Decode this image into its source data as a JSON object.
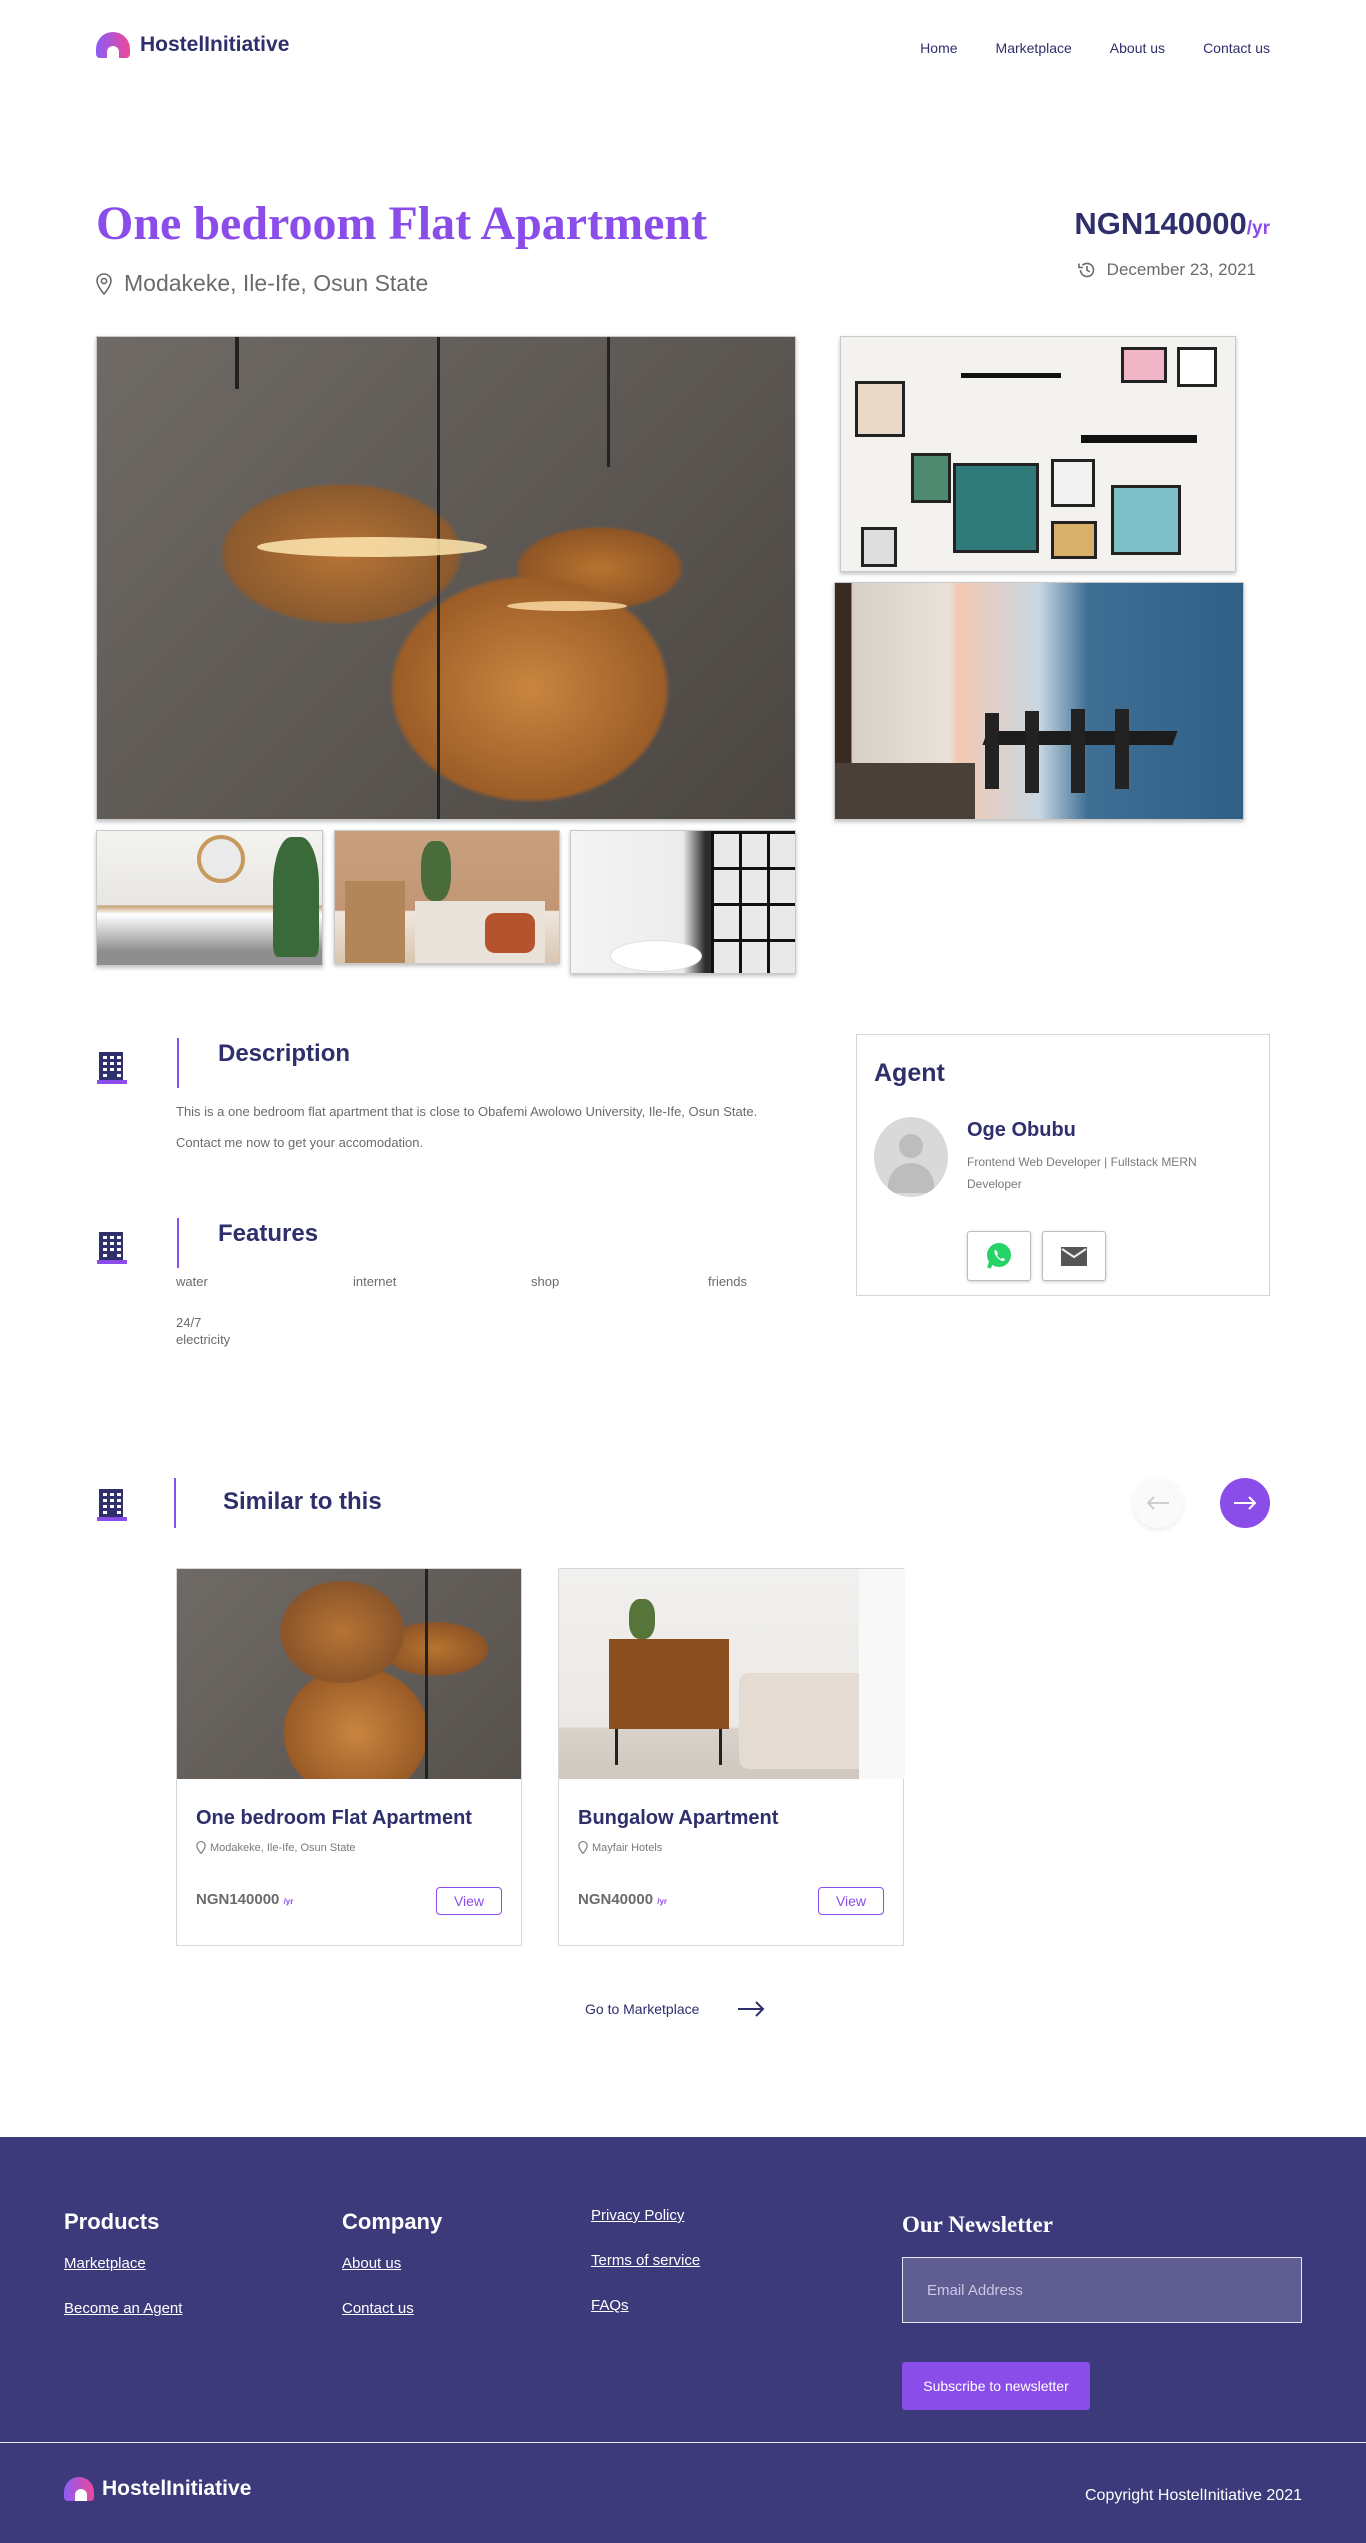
{
  "header": {
    "brand": "HostelInitiative",
    "nav": [
      "Home",
      "Marketplace",
      "About us",
      "Contact us"
    ]
  },
  "listing": {
    "title": "One bedroom Flat Apartment",
    "location": "Modakeke, Ile-Ife, Osun State",
    "price": "NGN140000",
    "price_unit": "/yr",
    "date": "December 23, 2021"
  },
  "description": {
    "heading": "Description",
    "text": "This is a one bedroom flat apartment that is close to Obafemi Awolowo University, Ile-Ife, Osun State. Contact me now to get your accomodation."
  },
  "features": {
    "heading": "Features",
    "items": [
      "water",
      "internet",
      "shop",
      "friends",
      "24/7 electricity"
    ]
  },
  "agent": {
    "heading": "Agent",
    "name": "Oge Obubu",
    "role": "Frontend Web Developer | Fullstack MERN Developer",
    "actions": [
      "whatsapp-icon",
      "mail-icon"
    ]
  },
  "similar": {
    "heading": "Similar to this",
    "cards": [
      {
        "title": "One bedroom Flat Apartment",
        "location": "Modakeke, Ile-Ife, Osun State",
        "price": "NGN140000",
        "unit": "/yr",
        "button": "View"
      },
      {
        "title": "Bungalow Apartment",
        "location": "Mayfair Hotels",
        "price": "NGN40000",
        "unit": "/yr",
        "button": "View"
      }
    ],
    "goto": "Go to Marketplace"
  },
  "footer": {
    "products": {
      "heading": "Products",
      "links": [
        "Marketplace",
        "Become an Agent"
      ]
    },
    "company": {
      "heading": "Company",
      "links": [
        "About us",
        "Contact us"
      ]
    },
    "legal": [
      "Privacy Policy",
      "Terms of service",
      "FAQs"
    ],
    "newsletter": {
      "heading": "Our Newsletter",
      "placeholder": "Email Address",
      "button": "Subscribe to newsletter"
    },
    "brand": "HostelInitiative",
    "copyright": "Copyright HostelInitiative 2021"
  },
  "colors": {
    "brand": "#2e2f6b",
    "accent": "#8b4dea",
    "footer_bg": "#3c3a7b",
    "whatsapp": "#25d366"
  }
}
